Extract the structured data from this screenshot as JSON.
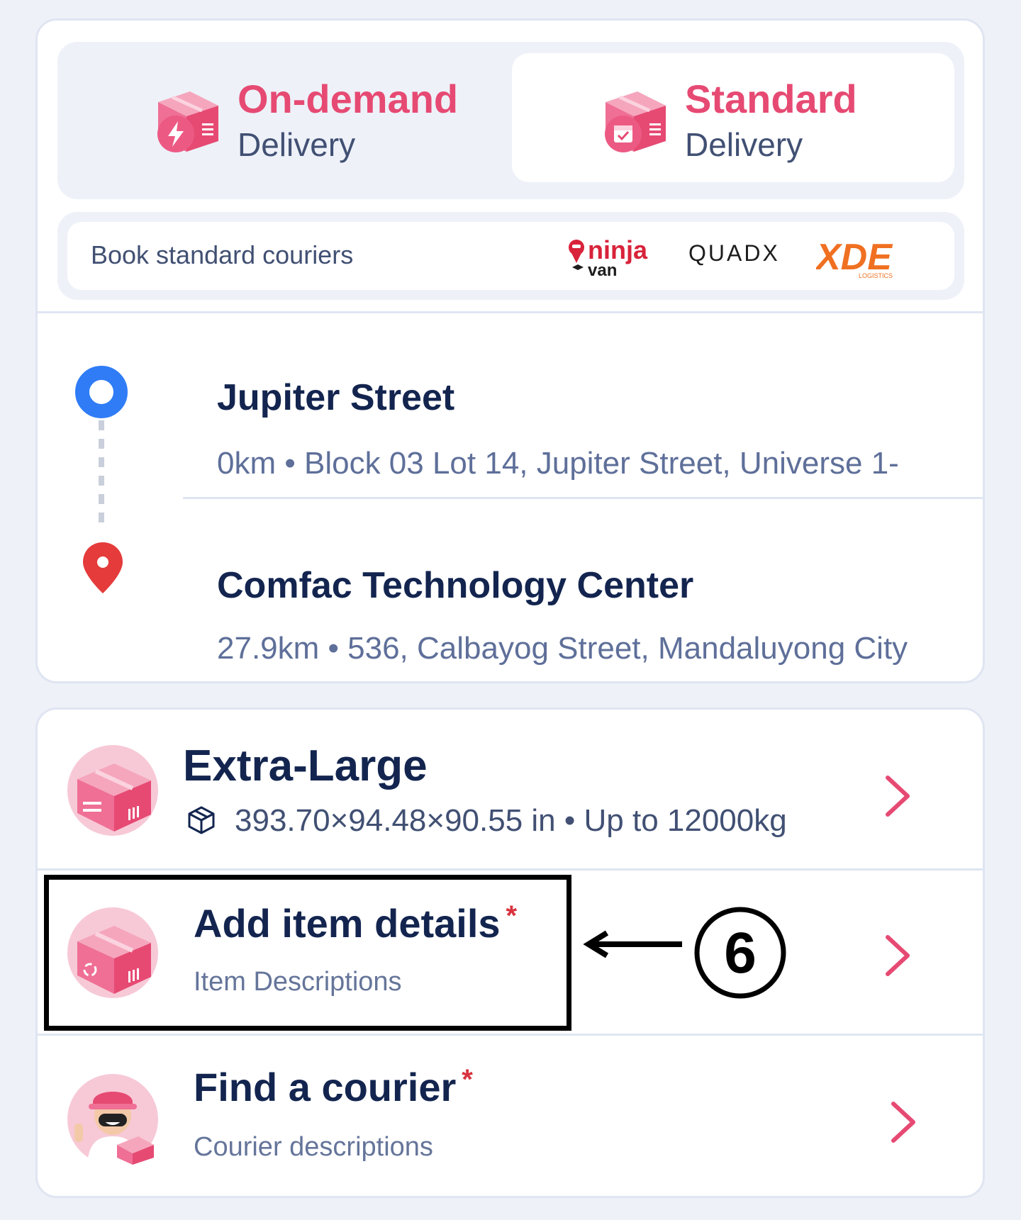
{
  "delivery_tabs": [
    {
      "title": "On-demand",
      "subtitle": "Delivery",
      "icon": "lightning-box-icon",
      "active": false
    },
    {
      "title": "Standard",
      "subtitle": "Delivery",
      "icon": "calendar-box-icon",
      "active": true
    }
  ],
  "couriers": {
    "label": "Book standard couriers",
    "logos": [
      {
        "name": "ninja-van-logo",
        "text_top": "ninja",
        "text_bottom": "van"
      },
      {
        "name": "quadx-logo",
        "text": "QUADX"
      },
      {
        "name": "xde-logo",
        "text": "XDE",
        "subtext": "LOGISTICS"
      }
    ]
  },
  "route": {
    "pickup": {
      "title": "Jupiter Street",
      "subtitle": "0km • Block 03 Lot 14, Jupiter Street, Universe 1-"
    },
    "dropoff": {
      "title": "Comfac Technology Center",
      "subtitle": "27.9km • 536, Calbayog Street, Mandaluyong City"
    }
  },
  "package": {
    "title": "Extra-Large",
    "details": "393.70×94.48×90.55 in • Up to 12000kg"
  },
  "item_details": {
    "title": "Add item details",
    "required_mark": "*",
    "subtitle": "Item Descriptions"
  },
  "courier_row": {
    "title": "Find a courier",
    "required_mark": "*",
    "subtitle": "Courier descriptions"
  },
  "annotation": {
    "number": "6"
  },
  "colors": {
    "accent": "#e64a73",
    "navy": "#13254f",
    "blue": "#2f7cf6",
    "red": "#e53b3b",
    "background": "#eef1f8"
  }
}
